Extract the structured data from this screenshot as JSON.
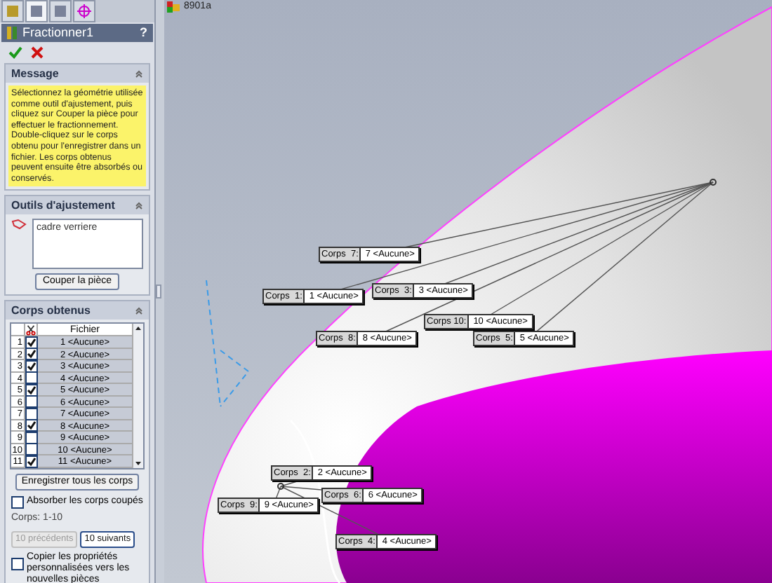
{
  "panel_tabs": [
    {
      "selected": false
    },
    {
      "selected": true
    },
    {
      "selected": false
    },
    {
      "selected": false
    }
  ],
  "property_manager": {
    "title": "Fractionner1",
    "help": "?"
  },
  "message": {
    "header": "Message",
    "text": "Sélectionnez la géométrie utilisée comme outil d'ajustement, puis cliquez sur Couper la pièce pour effectuer le fractionnement. Double-cliquez sur le corps obtenu pour l'enregistrer dans un fichier. Les corps obtenus peuvent ensuite être absorbés ou conservés."
  },
  "trim_tools": {
    "header": "Outils d'ajustement",
    "items": [
      "cadre verriere"
    ],
    "button": "Couper la pièce"
  },
  "resulting_bodies": {
    "header": "Corps obtenus",
    "columns": [
      "Fichier"
    ],
    "rows": [
      {
        "index": "1",
        "checked": true,
        "file": "1 <Aucune>"
      },
      {
        "index": "2",
        "checked": true,
        "file": "2 <Aucune>"
      },
      {
        "index": "3",
        "checked": true,
        "file": "3 <Aucune>"
      },
      {
        "index": "4",
        "checked": false,
        "file": "4 <Aucune>"
      },
      {
        "index": "5",
        "checked": true,
        "file": "5 <Aucune>"
      },
      {
        "index": "6",
        "checked": false,
        "file": "6 <Aucune>"
      },
      {
        "index": "7",
        "checked": false,
        "file": "7 <Aucune>"
      },
      {
        "index": "8",
        "checked": true,
        "file": "8 <Aucune>"
      },
      {
        "index": "9",
        "checked": false,
        "file": "9 <Aucune>"
      },
      {
        "index": "10",
        "checked": false,
        "file": "10 <Aucune>"
      },
      {
        "index": "11",
        "checked": true,
        "file": "11 <Aucune>"
      }
    ],
    "save_all": "Enregistrer tous les corps",
    "absorb": {
      "label": "Absorber les corps coupés",
      "checked": false
    },
    "range": "Corps: 1-10",
    "prev": {
      "label": "10 précédents",
      "disabled": true
    },
    "next": {
      "label": "10 suivants",
      "disabled": false
    },
    "copy_props": {
      "label": "Copier les propriétés personnalisées vers les nouvelles pièces",
      "checked": false
    }
  },
  "viewport": {
    "tree_root": "8901a",
    "callouts": [
      {
        "name": "Corps  7:",
        "file": "7 <Aucune>"
      },
      {
        "name": "Corps  1:",
        "file": "1 <Aucune>"
      },
      {
        "name": "Corps  3:",
        "file": "3 <Aucune>"
      },
      {
        "name": "Corps 10:",
        "file": "10 <Aucune>"
      },
      {
        "name": "Corps  8:",
        "file": "8 <Aucune>"
      },
      {
        "name": "Corps  5:",
        "file": "5 <Aucune>"
      },
      {
        "name": "Corps  2:",
        "file": "2 <Aucune>"
      },
      {
        "name": "Corps  9:",
        "file": "9 <Aucune>"
      },
      {
        "name": "Corps  6:",
        "file": "6 <Aucune>"
      },
      {
        "name": "Corps  4:",
        "file": "4 <Aucune>"
      }
    ]
  }
}
